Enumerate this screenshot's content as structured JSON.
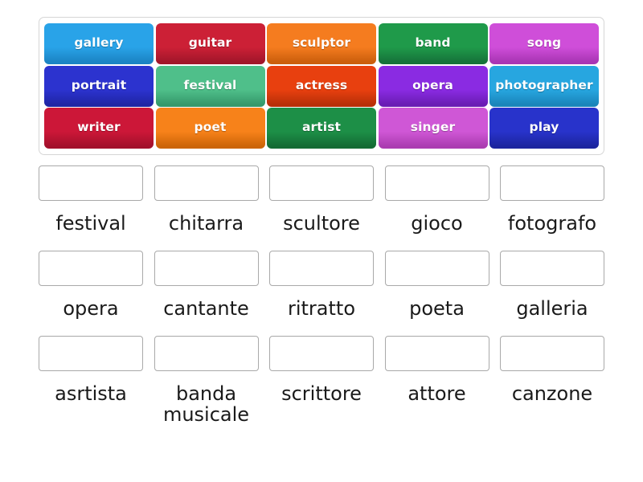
{
  "tile_bank": {
    "name": "word-tile-bank",
    "rows": [
      [
        {
          "label": "gallery",
          "color": "#29a3e8",
          "color_dark": "#1b84c4"
        },
        {
          "label": "guitar",
          "color": "#cc2036",
          "color_dark": "#a2162a"
        },
        {
          "label": "sculptor",
          "color": "#f57c1f",
          "color_dark": "#cb5f0c"
        },
        {
          "label": "band",
          "color": "#1f9a4a",
          "color_dark": "#16733a"
        },
        {
          "label": "song",
          "color": "#cf4ed9",
          "color_dark": "#a935b4"
        }
      ],
      [
        {
          "label": "portrait",
          "color": "#2c33cf",
          "color_dark": "#1f25a5"
        },
        {
          "label": "festival",
          "color": "#4fbf8a",
          "color_dark": "#35996b"
        },
        {
          "label": "actress",
          "color": "#e8400f",
          "color_dark": "#b82f08"
        },
        {
          "label": "opera",
          "color": "#8a2be2",
          "color_dark": "#6a1cb4"
        },
        {
          "label": "photographer",
          "color": "#27a6e0",
          "color_dark": "#1a85ba"
        }
      ],
      [
        {
          "label": "writer",
          "color": "#cc1738",
          "color_dark": "#a3102b"
        },
        {
          "label": "poet",
          "color": "#f7821a",
          "color_dark": "#cc6508"
        },
        {
          "label": "artist",
          "color": "#1d8f47",
          "color_dark": "#146b34"
        },
        {
          "label": "singer",
          "color": "#cf57d6",
          "color_dark": "#ab3cb1"
        },
        {
          "label": "play",
          "color": "#2833cb",
          "color_dark": "#1c259f"
        }
      ]
    ]
  },
  "answer_grid": {
    "name": "answer-drop-grid",
    "rows": [
      [
        {
          "label": "festival",
          "dropped": ""
        },
        {
          "label": "chitarra",
          "dropped": ""
        },
        {
          "label": "scultore",
          "dropped": ""
        },
        {
          "label": "gioco",
          "dropped": ""
        },
        {
          "label": "fotografo",
          "dropped": ""
        }
      ],
      [
        {
          "label": "opera",
          "dropped": ""
        },
        {
          "label": "cantante",
          "dropped": ""
        },
        {
          "label": "ritratto",
          "dropped": ""
        },
        {
          "label": "poeta",
          "dropped": ""
        },
        {
          "label": "galleria",
          "dropped": ""
        }
      ],
      [
        {
          "label": "asrtista",
          "dropped": ""
        },
        {
          "label": "banda musicale",
          "dropped": ""
        },
        {
          "label": "scrittore",
          "dropped": ""
        },
        {
          "label": "attore",
          "dropped": ""
        },
        {
          "label": "canzone",
          "dropped": ""
        }
      ]
    ]
  },
  "theme": {
    "page_background": "#ffffff",
    "bank_border": "#d6d6d6",
    "dropzone_border": "#a9a9a9",
    "label_color": "#1a1a1a",
    "tile_text_color": "#ffffff"
  }
}
